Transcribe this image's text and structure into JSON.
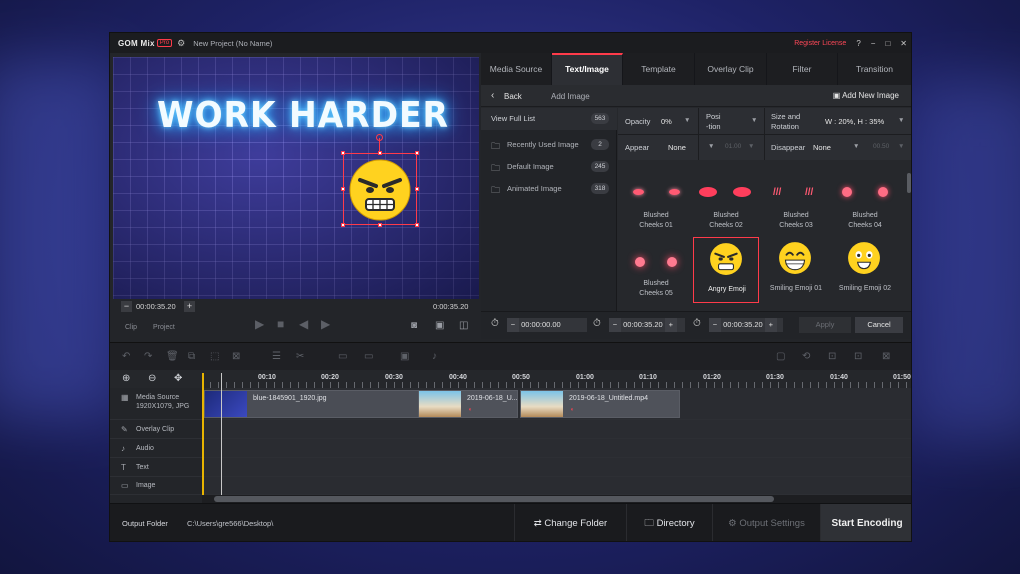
{
  "app": {
    "logo": "GOM Mix",
    "badge": "Pro",
    "project_title": "New Project (No Name)",
    "register_license": "Register License",
    "help": "?",
    "minimize": "−",
    "maximize": "□",
    "close": "✕"
  },
  "preview": {
    "neon_text": "WORK HARDER",
    "current_time": "00:00:35.20",
    "total_time": "0:00:35.20",
    "progress": 1.0,
    "mode_tabs": [
      "Clip",
      "Project"
    ]
  },
  "tabs": [
    "Media Source",
    "Text/Image",
    "Template",
    "Overlay Clip",
    "Filter",
    "Transition"
  ],
  "active_tab": "Text/Image",
  "nav": {
    "back": "Back",
    "add_image": "Add Image",
    "add_new_image": "Add New Image"
  },
  "sidebar": {
    "items": [
      {
        "label": "View Full List",
        "count": "563"
      },
      {
        "label": "Recently Used Image",
        "count": "2"
      },
      {
        "label": "Default Image",
        "count": "245"
      },
      {
        "label": "Animated Image",
        "count": "318"
      }
    ]
  },
  "props": {
    "opacity_label": "Opacity",
    "opacity_value": "0%",
    "position_label_1": "Posi",
    "position_label_2": "-tion",
    "size_label_1": "Size and",
    "size_label_2": "Rotation",
    "size_value": "W : 20%, H : 35%",
    "appear_label": "Appear",
    "appear_value": "None",
    "appear_time": "01.00",
    "disappear_label": "Disappear",
    "disappear_value": "None",
    "disappear_time": "00.50"
  },
  "gallery": {
    "items": [
      {
        "label1": "Blushed",
        "label2": "Cheeks 01"
      },
      {
        "label1": "Blushed",
        "label2": "Cheeks 02"
      },
      {
        "label1": "Blushed",
        "label2": "Cheeks 03"
      },
      {
        "label1": "Blushed",
        "label2": "Cheeks 04"
      },
      {
        "label1": "Blushed",
        "label2": "Cheeks 05"
      },
      {
        "label1": "Angry Emoji",
        "label2": ""
      },
      {
        "label1": "Smiling Emoji 01",
        "label2": ""
      },
      {
        "label1": "Smiling Emoji 02",
        "label2": ""
      }
    ],
    "selected": "Angry Emoji"
  },
  "time_fields": [
    "00:00:00.00",
    "00:00:35.20",
    "00:00:35.20"
  ],
  "buttons": {
    "apply": "Apply",
    "cancel": "Cancel"
  },
  "ruler_labels": [
    "00:10",
    "00:20",
    "00:30",
    "00:40",
    "00:50",
    "01:00",
    "01:10",
    "01:20",
    "01:30",
    "01:40",
    "01:50"
  ],
  "tracks": {
    "media_source": "Media Source",
    "media_source_res": "1920X1079, JPG",
    "overlay_clip": "Overlay Clip",
    "audio": "Audio",
    "text": "Text",
    "image": "Image"
  },
  "clips": [
    "blue-1845901_1920.jpg",
    "2019-06-18_U...",
    "2019-06-18_Untitled.mp4"
  ],
  "footer": {
    "output_folder_label": "Output Folder",
    "output_folder_path": "C:\\Users\\gre566\\Desktop\\",
    "change_folder": "Change Folder",
    "directory": "Directory",
    "output_settings": "Output Settings",
    "start_encoding": "Start Encoding"
  },
  "colors": {
    "accent": "#ff3b4a",
    "playhead": "#e8b400",
    "neon": "#2ea6ff"
  }
}
